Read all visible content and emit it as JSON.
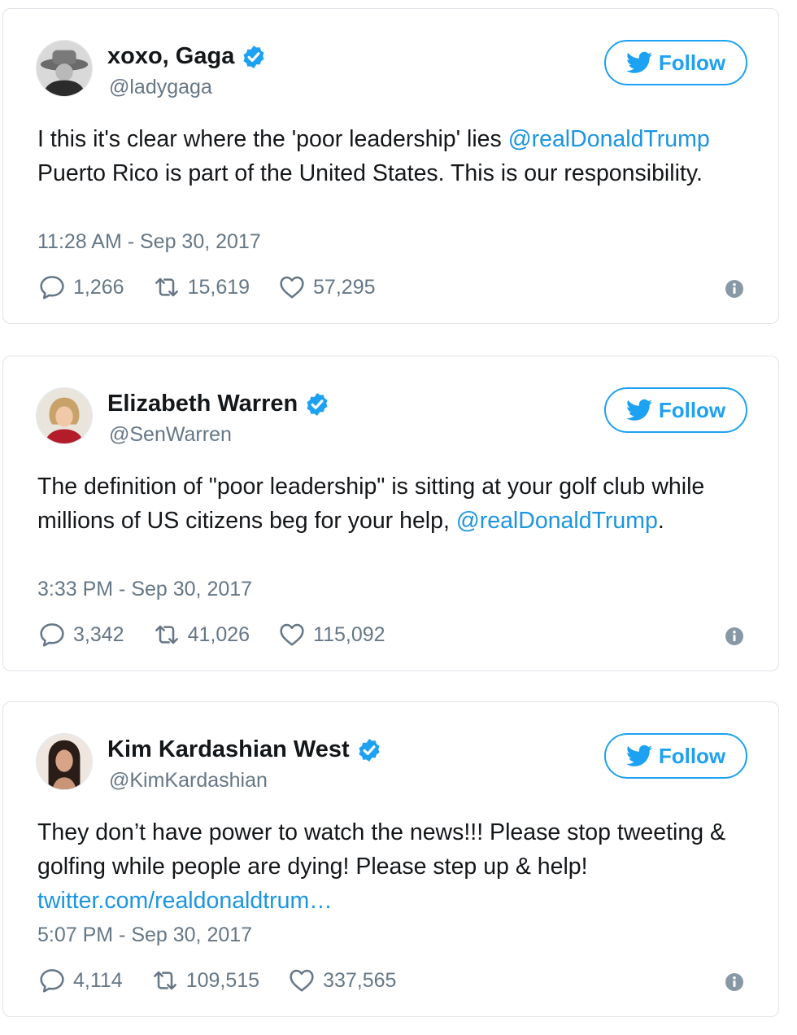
{
  "tweets": [
    {
      "name": "xoxo, Gaga",
      "handle": "@ladygaga",
      "follow_label": "Follow",
      "text_1": "I this it's clear where the 'poor leadership' lies ",
      "mention": "@realDonaldTrump",
      "text_2": " Puerto Rico is part of the United States. This is our responsibility.",
      "timestamp": "11:28 AM - Sep 30, 2017",
      "replies": "1,266",
      "retweets": "15,619",
      "likes": "57,295"
    },
    {
      "name": "Elizabeth Warren",
      "handle": "@SenWarren",
      "follow_label": "Follow",
      "text_1": "The definition of \"poor leadership\" is sitting at your golf club while millions of US citizens beg for your help, ",
      "mention": "@realDonaldTrump",
      "text_2": ".",
      "timestamp": "3:33 PM - Sep 30, 2017",
      "replies": "3,342",
      "retweets": "41,026",
      "likes": "115,092"
    },
    {
      "name": "Kim Kardashian West",
      "handle": "@KimKardashian",
      "follow_label": "Follow",
      "text_1": "They don’t have power to watch the news!!! Please stop tweeting & golfing while people are dying! Please step up & help! ",
      "link": "twitter.com/realdonaldtrum…",
      "timestamp": "5:07 PM - Sep 30, 2017",
      "replies": "4,114",
      "retweets": "109,515",
      "likes": "337,565"
    }
  ],
  "colors": {
    "accent": "#1da1f2",
    "link": "#1b95e0",
    "muted": "#657786",
    "text": "#14171a",
    "border": "#dfe3e8"
  },
  "icons": [
    "avatar",
    "verified-badge-icon",
    "twitter-bird-icon",
    "reply-icon",
    "retweet-icon",
    "like-heart-icon",
    "info-icon"
  ]
}
